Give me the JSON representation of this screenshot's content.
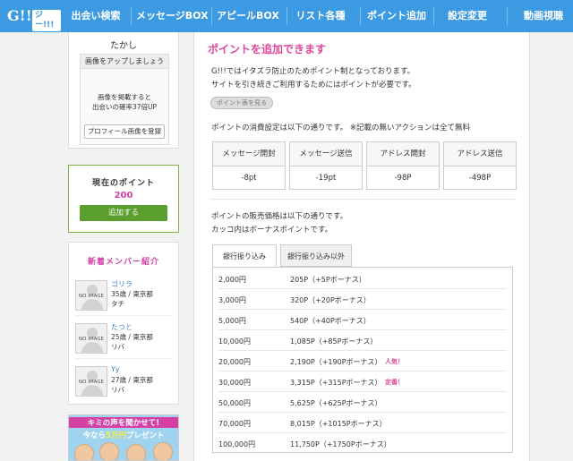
{
  "logo": {
    "letter": "G!!!",
    "tag": "ジー!!!"
  },
  "nav": [
    "出会い検索",
    "メッセージBOX",
    "アピールBOX",
    "リスト各種",
    "ポイント追加",
    "設定変更",
    "動画視聴"
  ],
  "profile": {
    "name": "たかし",
    "upload_head": "画像をアップしましょう",
    "upload_note_1": "画像を掲載すると",
    "upload_note_2": "出会いの確率37倍UP",
    "upload_button": "プロフィール画像を登録"
  },
  "points": {
    "label": "現在のポイント",
    "value": "200",
    "add_button": "追加する"
  },
  "members": {
    "title": "新着メンバー紹介",
    "no_image": "NO IMAGE",
    "items": [
      {
        "name": "ゴリラ",
        "age_area": "35歳 / 東京都",
        "job": "タチ"
      },
      {
        "name": "たつと",
        "age_area": "25歳 / 東京都",
        "job": "リバ"
      },
      {
        "name": "Yy",
        "age_area": "27歳 / 東京都",
        "job": "リバ"
      }
    ]
  },
  "banner": {
    "line1": "キミの声を聞かせて!",
    "line2_pre": "今なら",
    "line2_hl": "5万円",
    "line2_post": "プレゼント"
  },
  "main": {
    "title": "ポイントを追加できます",
    "intro_1": "G!!!ではイタズラ防止のためポイント制となっております。",
    "intro_2": "サイトを引き続きご利用するためにはポイントが必要です。",
    "points_table_button": "ポイント表を見る",
    "consume_text": "ポイントの消費設定は以下の通りです。 ※記載の無いアクションは全て無料",
    "costs": [
      {
        "action": "メッセージ開封",
        "cost": "-8pt"
      },
      {
        "action": "メッセージ送信",
        "cost": "-19pt"
      },
      {
        "action": "アドレス開封",
        "cost": "-98P"
      },
      {
        "action": "アドレス送信",
        "cost": "-498P"
      }
    ],
    "sale_1": "ポイントの販売価格は以下の通りです。",
    "sale_2": "カッコ内はボーナスポイントです。",
    "tabs": [
      "銀行振り込み",
      "銀行振り込み以外"
    ],
    "prices": [
      {
        "yen": "2,000円",
        "points": "205P（+5Pボーナス）",
        "badge": ""
      },
      {
        "yen": "3,000円",
        "points": "320P（+20Pボーナス）",
        "badge": ""
      },
      {
        "yen": "5,000円",
        "points": "540P（+40Pボーナス）",
        "badge": ""
      },
      {
        "yen": "10,000円",
        "points": "1,085P（+85Pボーナス）",
        "badge": ""
      },
      {
        "yen": "20,000円",
        "points": "2,190P（+190Pボーナス）",
        "badge": "人気！"
      },
      {
        "yen": "30,000円",
        "points": "3,315P（+315Pボーナス）",
        "badge": "定番！"
      },
      {
        "yen": "50,000円",
        "points": "5,625P（+625Pボーナス）",
        "badge": ""
      },
      {
        "yen": "70,000円",
        "points": "8,015P（+1015Pボーナス）",
        "badge": ""
      },
      {
        "yen": "100,000円",
        "points": "11,750P（+1750Pボーナス）",
        "badge": ""
      }
    ]
  },
  "colors": {
    "nav_bg": "#3b9ae1",
    "accent_pink": "#e0469b",
    "add_green": "#5a9e2d"
  }
}
